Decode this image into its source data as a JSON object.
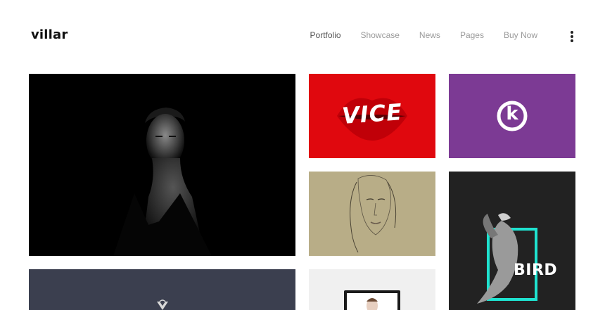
{
  "brand": {
    "logo_text": "villar"
  },
  "nav": {
    "items": [
      {
        "label": "Portfolio",
        "active": true
      },
      {
        "label": "Showcase",
        "active": false
      },
      {
        "label": "News",
        "active": false
      },
      {
        "label": "Pages",
        "active": false
      },
      {
        "label": "Buy Now",
        "active": false
      }
    ],
    "menu_icon": "vertical-dots-icon"
  },
  "portfolio": {
    "tiles": [
      {
        "name": "portrait-man",
        "bg": "#000000"
      },
      {
        "name": "vice",
        "text": "VICE",
        "bg": "#e0080e"
      },
      {
        "name": "k-logo",
        "text": "k",
        "bg": "#7c3a94"
      },
      {
        "name": "sketch-woman",
        "bg": "#b8ad87"
      },
      {
        "name": "bird",
        "text": "BIRD",
        "bg": "#222222",
        "accent": "#1fe3d0"
      },
      {
        "name": "v-logo",
        "bg": "#3b3f4f"
      },
      {
        "name": "laptop-mockup",
        "bg": "#f0f0f0"
      }
    ]
  }
}
